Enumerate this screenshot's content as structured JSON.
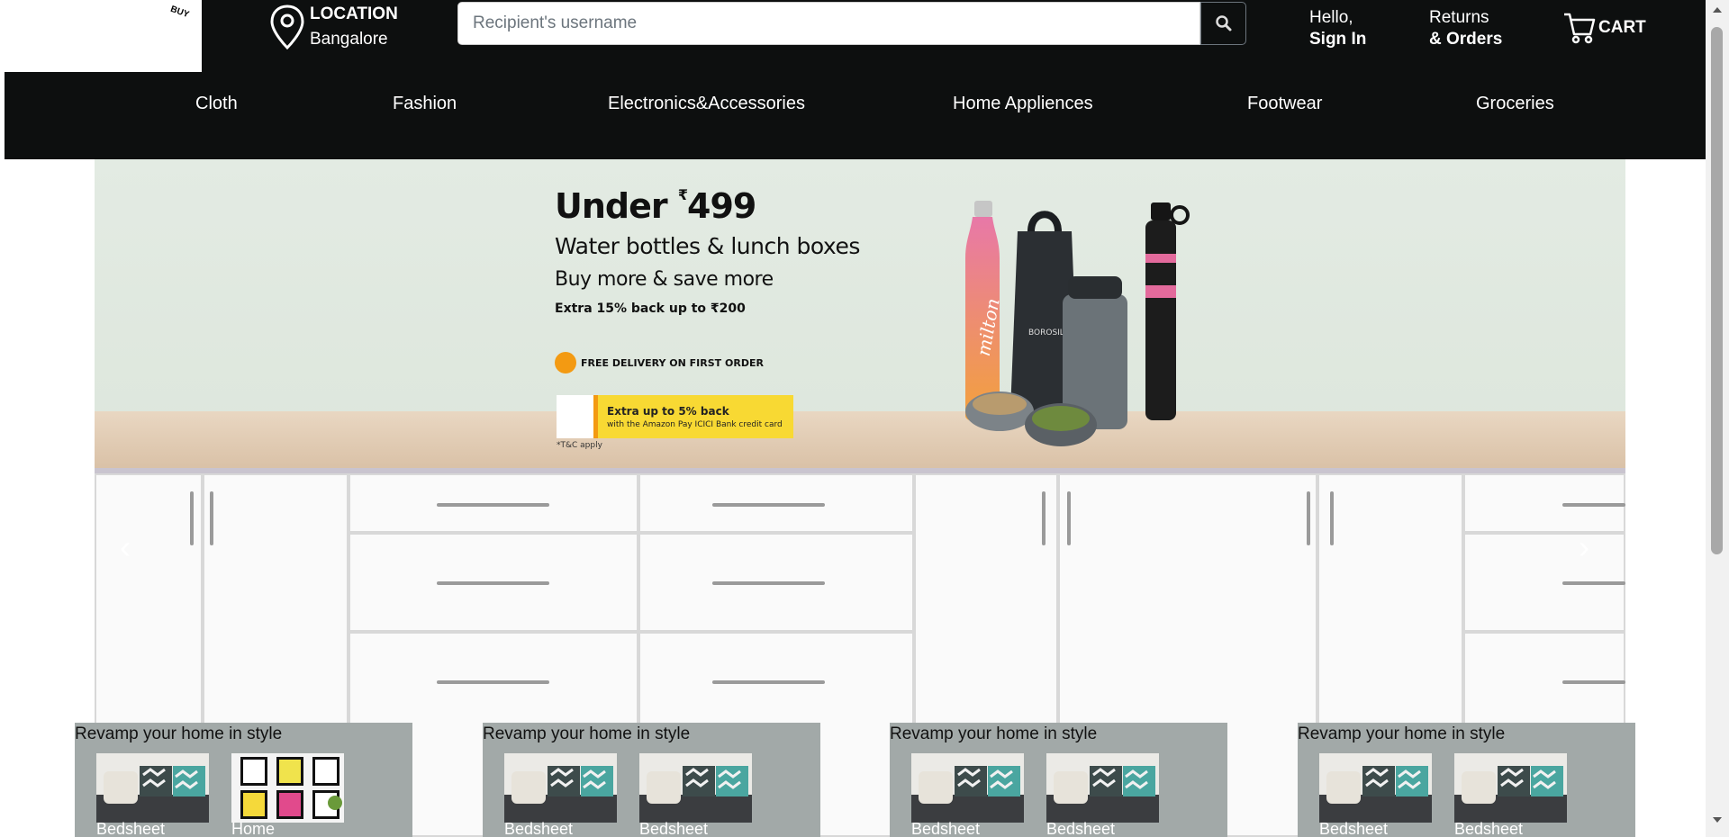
{
  "logo": {
    "text": "BUY"
  },
  "location": {
    "title": "LOCATION",
    "city": "Bangalore"
  },
  "search": {
    "placeholder": "Recipient's username"
  },
  "account": {
    "line1": "Hello,",
    "line2": "Sign In"
  },
  "orders": {
    "line1": "Returns",
    "line2": "& Orders"
  },
  "cart": {
    "label": "CART"
  },
  "nav": [
    "Cloth",
    "Fashion",
    "Electronics&Accessories",
    "Home Appliences",
    "Footwear",
    "Groceries"
  ],
  "banner": {
    "title": "Under",
    "currency": "₹",
    "price": "499",
    "subtitle": "Water bottles & lunch boxes",
    "subtitle2": "Buy more & save more",
    "extra": "Extra 15% back up to ₹200",
    "free_delivery": "FREE DELIVERY ON FIRST ORDER",
    "card_line1": "Extra up to 5% back",
    "card_line2": "with the Amazon Pay ICICI Bank credit card",
    "tc": "*T&C apply",
    "brand_bottle": "milton",
    "brand_box": "BOROSIL"
  },
  "cards": [
    {
      "title": "Revamp your home in style",
      "items": [
        "Bedsheet",
        "Home"
      ]
    },
    {
      "title": "Revamp your home in style",
      "items": [
        "Bedsheet",
        "Bedsheet"
      ]
    },
    {
      "title": "Revamp your home in style",
      "items": [
        "Bedsheet",
        "Bedsheet"
      ]
    },
    {
      "title": "Revamp your home in style",
      "items": [
        "Bedsheet",
        "Bedsheet"
      ]
    }
  ],
  "colors": {
    "header_bg": "#0d0f0f",
    "card_bg": "#a2a9a8",
    "accent": "#f39a12"
  }
}
